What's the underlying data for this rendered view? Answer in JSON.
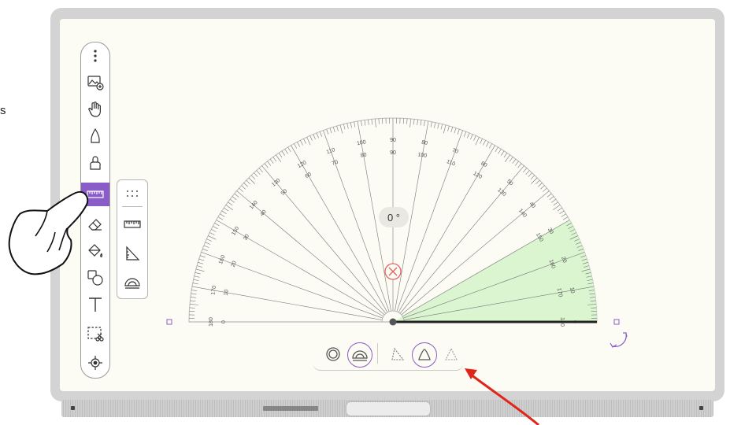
{
  "edge_text": "s",
  "toolbar": {
    "items": [
      {
        "name": "more-menu-icon",
        "active": false
      },
      {
        "name": "insert-image-icon",
        "active": false
      },
      {
        "name": "hand-pan-icon",
        "active": false
      },
      {
        "name": "pen-icon",
        "active": false
      },
      {
        "name": "highlighter-icon",
        "active": false
      },
      {
        "name": "ruler-icon",
        "active": true
      },
      {
        "name": "eraser-icon",
        "active": false
      },
      {
        "name": "fill-bucket-icon",
        "active": false
      },
      {
        "name": "shapes-icon",
        "active": false
      },
      {
        "name": "text-icon",
        "active": false
      },
      {
        "name": "select-cut-icon",
        "active": false
      },
      {
        "name": "locate-icon",
        "active": false
      }
    ]
  },
  "measure_panel": {
    "items": [
      "more-dots-icon",
      "ruler-icon",
      "set-square-icon",
      "protractor-icon"
    ]
  },
  "protractor": {
    "angle_label": "0 °",
    "outer_scale": [
      "0",
      "10",
      "20",
      "30",
      "40",
      "50",
      "60",
      "70",
      "80",
      "90",
      "100",
      "110",
      "120",
      "130",
      "140",
      "150",
      "160",
      "170",
      "180"
    ],
    "inner_scale": [
      "180",
      "170",
      "160",
      "150",
      "140",
      "130",
      "120",
      "110",
      "100",
      "90",
      "80",
      "70",
      "60",
      "50",
      "40",
      "30",
      "20",
      "10",
      "0"
    ],
    "measured_sector_deg": 30,
    "highlight_color": "#daf5d0"
  },
  "bottom_bar": {
    "items": [
      "circle-mode-icon",
      "semicircle-mode-icon",
      "triangle-left-icon",
      "triangle-center-icon",
      "triangle-right-icon"
    ],
    "selected": [
      "semicircle-mode-icon",
      "triangle-center-icon"
    ]
  },
  "colors": {
    "accent": "#8a5cc7",
    "arrow": "#e0261b",
    "close": "#e06060"
  }
}
